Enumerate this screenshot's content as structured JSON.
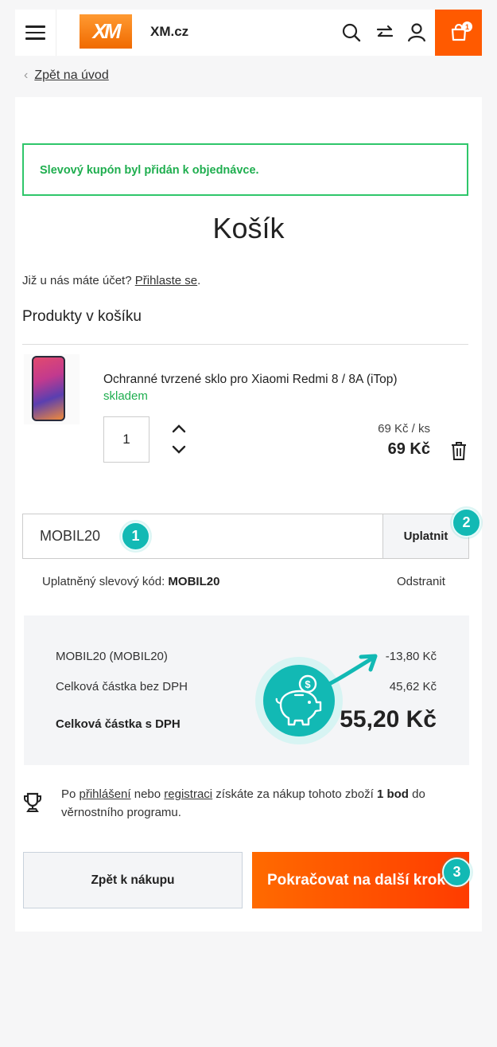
{
  "header": {
    "menu_icon": "hamburger-icon",
    "logo_text": "XM",
    "site_name": "XM.cz",
    "icons": [
      "search-icon",
      "compare-icon",
      "user-icon",
      "cart-icon"
    ],
    "cart_count": "1",
    "accent": "#ff5a00"
  },
  "nav": {
    "back_label": "Zpět na úvod"
  },
  "alert": {
    "message": "Slevový kupón byl přidán k objednávce.",
    "color": "#2fc66a"
  },
  "page": {
    "title": "Košík"
  },
  "login": {
    "prompt": "Již u nás máte účet?",
    "link": "Přihlaste se",
    "suffix": "."
  },
  "products": {
    "section_title": "Produkty v košíku",
    "items": [
      {
        "name": "Ochranné tvrzené sklo pro Xiaomi Redmi 8 / 8A (iTop)",
        "availability": "skladem",
        "quantity": "1",
        "unit_price": "69 Kč / ks",
        "total_price": "69 Kč"
      }
    ]
  },
  "coupon": {
    "code_value": "MOBIL20",
    "apply_label": "Uplatnit",
    "applied_label": "Uplatněný slevový kód:",
    "applied_code": "MOBIL20",
    "remove_label": "Odstranit"
  },
  "badges": {
    "b1": "1",
    "b2": "2",
    "b3": "3",
    "color": "#12b9b4"
  },
  "summary": {
    "discount_label": "MOBIL20 (MOBIL20)",
    "discount_value": "-13,80 Kč",
    "net_label": "Celková částka bez DPH",
    "net_value": "45,62 Kč",
    "total_label": "Celková částka s DPH",
    "total_value": "55,20 Kč"
  },
  "loyalty": {
    "p1": "Po ",
    "link1": "přihlášení",
    "p2": " nebo ",
    "link2": "registraci",
    "p3": " získáte za nákup tohoto zboží ",
    "points": "1 bod",
    "p4": " do věrnostního programu."
  },
  "actions": {
    "back_label": "Zpět k nákupu",
    "next_label": "Pokračovat na další krok"
  }
}
